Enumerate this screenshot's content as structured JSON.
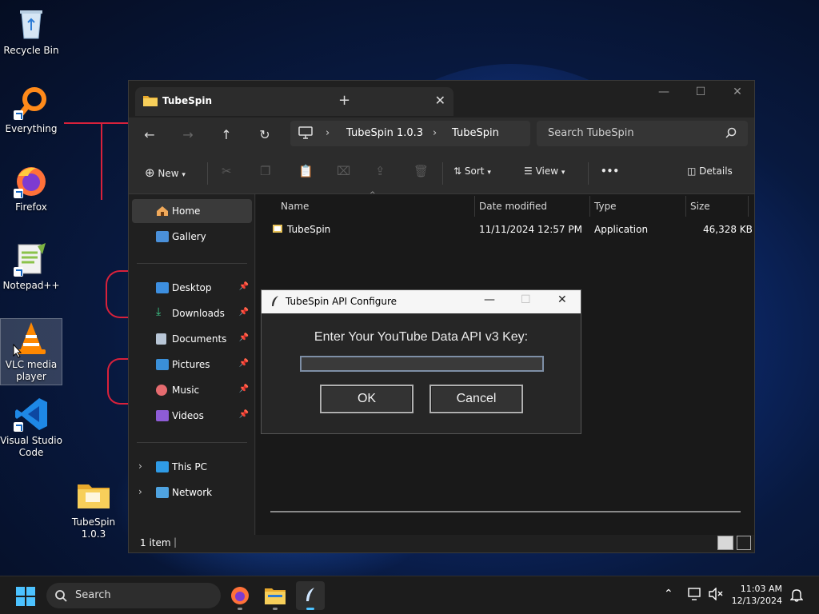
{
  "desktop": {
    "icons": [
      {
        "label": "Recycle Bin"
      },
      {
        "label": "Everything"
      },
      {
        "label": "Firefox"
      },
      {
        "label": "Notepad++"
      },
      {
        "label": "VLC media player"
      },
      {
        "label": "Visual Studio Code"
      },
      {
        "label": "TubeSpin 1.0.3"
      }
    ]
  },
  "explorer": {
    "tab_title": "TubeSpin",
    "tab_close": "✕",
    "new_tab": "+",
    "window_controls": {
      "minimize": "—",
      "maximize": "☐",
      "close": "✕"
    },
    "breadcrumb": [
      "TubeSpin 1.0.3",
      "TubeSpin"
    ],
    "search_placeholder": "Search TubeSpin",
    "commands": {
      "new": "New",
      "sort": "Sort",
      "view": "View",
      "more": "•••",
      "details": "Details"
    },
    "sidebar": {
      "top": [
        {
          "label": "Home"
        },
        {
          "label": "Gallery"
        }
      ],
      "quick_access": [
        {
          "label": "Desktop"
        },
        {
          "label": "Downloads"
        },
        {
          "label": "Documents"
        },
        {
          "label": "Pictures"
        },
        {
          "label": "Music"
        },
        {
          "label": "Videos"
        }
      ],
      "bottom": [
        {
          "label": "This PC"
        },
        {
          "label": "Network"
        }
      ]
    },
    "columns": [
      "Name",
      "Date modified",
      "Type",
      "Size"
    ],
    "files": [
      {
        "name": "TubeSpin",
        "date": "11/11/2024 12:57 PM",
        "type": "Application",
        "size": "46,328 KB"
      }
    ],
    "status": "1 item"
  },
  "dialog": {
    "title": "TubeSpin API Configure",
    "prompt": "Enter Your YouTube Data API v3 Key:",
    "api_key_value": "",
    "ok_label": "OK",
    "cancel_label": "Cancel",
    "controls": {
      "minimize": "—",
      "maximize": "☐",
      "close": "✕"
    }
  },
  "taskbar": {
    "search_label": "Search",
    "time": "11:03 AM",
    "date": "12/13/2024"
  },
  "colors": {
    "accent": "#4cc2ff",
    "annotation_red": "#d9213b",
    "folder_yellow": "#f3c54a"
  }
}
